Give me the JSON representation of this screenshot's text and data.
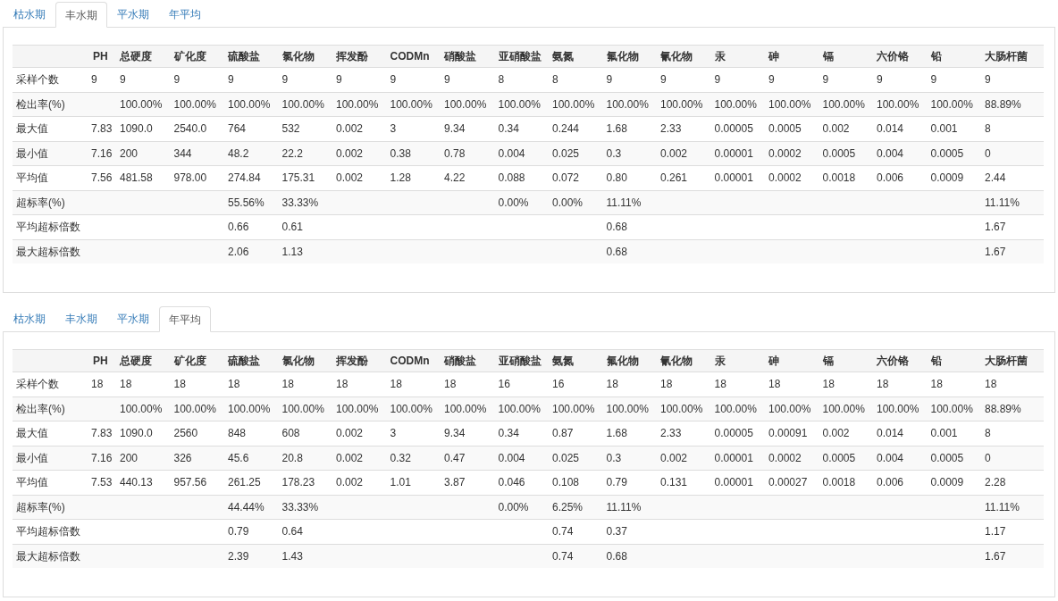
{
  "sections": [
    {
      "tabs": [
        {
          "label": "枯水期",
          "selected": false
        },
        {
          "label": "丰水期",
          "selected": true
        },
        {
          "label": "平水期",
          "selected": false
        },
        {
          "label": "年平均",
          "selected": false
        }
      ],
      "table": {
        "columns": [
          "PH",
          "总硬度",
          "矿化度",
          "硫酸盐",
          "氯化物",
          "挥发酚",
          "CODMn",
          "硝酸盐",
          "亚硝酸盐",
          "氨氮",
          "氟化物",
          "氰化物",
          "汞",
          "砷",
          "镉",
          "六价铬",
          "铅",
          "大肠杆菌"
        ],
        "rows": [
          {
            "label": "采样个数",
            "cells": [
              "9",
              "9",
              "9",
              "9",
              "9",
              "9",
              "9",
              "9",
              "8",
              "8",
              "9",
              "9",
              "9",
              "9",
              "9",
              "9",
              "9",
              "9"
            ]
          },
          {
            "label": "检出率(%)",
            "cells": [
              null,
              "100.00%",
              "100.00%",
              "100.00%",
              "100.00%",
              "100.00%",
              "100.00%",
              "100.00%",
              "100.00%",
              "100.00%",
              "100.00%",
              "100.00%",
              "100.00%",
              "100.00%",
              "100.00%",
              "100.00%",
              "100.00%",
              "88.89%"
            ]
          },
          {
            "label": "最大值",
            "cells": [
              "7.83",
              "1090.0",
              "2540.0",
              "764",
              "532",
              "0.002",
              "3",
              "9.34",
              "0.34",
              "0.244",
              "1.68",
              "2.33",
              "0.00005",
              "0.0005",
              "0.002",
              "0.014",
              "0.001",
              "8"
            ]
          },
          {
            "label": "最小值",
            "cells": [
              "7.16",
              "200",
              "344",
              "48.2",
              "22.2",
              "0.002",
              "0.38",
              "0.78",
              "0.004",
              "0.025",
              "0.3",
              "0.002",
              "0.00001",
              "0.0002",
              "0.0005",
              "0.004",
              "0.0005",
              "0"
            ]
          },
          {
            "label": "平均值",
            "cells": [
              "7.56",
              "481.58",
              "978.00",
              "274.84",
              "175.31",
              "0.002",
              "1.28",
              "4.22",
              "0.088",
              "0.072",
              "0.80",
              "0.261",
              "0.00001",
              "0.0002",
              "0.0018",
              "0.006",
              "0.0009",
              "2.44"
            ]
          },
          {
            "label": "超标率(%)",
            "cells": [
              null,
              null,
              null,
              "55.56%",
              "33.33%",
              null,
              null,
              null,
              "0.00%",
              "0.00%",
              "11.11%",
              null,
              null,
              null,
              null,
              null,
              null,
              "11.11%"
            ]
          },
          {
            "label": "平均超标倍数",
            "cells": [
              null,
              null,
              null,
              "0.66",
              "0.61",
              null,
              null,
              null,
              null,
              null,
              "0.68",
              null,
              null,
              null,
              null,
              null,
              null,
              "1.67"
            ]
          },
          {
            "label": "最大超标倍数",
            "cells": [
              null,
              null,
              null,
              "2.06",
              "1.13",
              null,
              null,
              null,
              null,
              null,
              "0.68",
              null,
              null,
              null,
              null,
              null,
              null,
              "1.67"
            ]
          }
        ]
      }
    },
    {
      "tabs": [
        {
          "label": "枯水期",
          "selected": false
        },
        {
          "label": "丰水期",
          "selected": false
        },
        {
          "label": "平水期",
          "selected": false
        },
        {
          "label": "年平均",
          "selected": true
        }
      ],
      "table": {
        "columns": [
          "PH",
          "总硬度",
          "矿化度",
          "硫酸盐",
          "氯化物",
          "挥发酚",
          "CODMn",
          "硝酸盐",
          "亚硝酸盐",
          "氨氮",
          "氟化物",
          "氰化物",
          "汞",
          "砷",
          "镉",
          "六价铬",
          "铅",
          "大肠杆菌"
        ],
        "rows": [
          {
            "label": "采样个数",
            "cells": [
              "18",
              "18",
              "18",
              "18",
              "18",
              "18",
              "18",
              "18",
              "16",
              "16",
              "18",
              "18",
              "18",
              "18",
              "18",
              "18",
              "18",
              "18"
            ]
          },
          {
            "label": "检出率(%)",
            "cells": [
              null,
              "100.00%",
              "100.00%",
              "100.00%",
              "100.00%",
              "100.00%",
              "100.00%",
              "100.00%",
              "100.00%",
              "100.00%",
              "100.00%",
              "100.00%",
              "100.00%",
              "100.00%",
              "100.00%",
              "100.00%",
              "100.00%",
              "88.89%"
            ]
          },
          {
            "label": "最大值",
            "cells": [
              "7.83",
              "1090.0",
              "2560",
              "848",
              "608",
              "0.002",
              "3",
              "9.34",
              "0.34",
              "0.87",
              "1.68",
              "2.33",
              "0.00005",
              "0.00091",
              "0.002",
              "0.014",
              "0.001",
              "8"
            ]
          },
          {
            "label": "最小值",
            "cells": [
              "7.16",
              "200",
              "326",
              "45.6",
              "20.8",
              "0.002",
              "0.32",
              "0.47",
              "0.004",
              "0.025",
              "0.3",
              "0.002",
              "0.00001",
              "0.0002",
              "0.0005",
              "0.004",
              "0.0005",
              "0"
            ]
          },
          {
            "label": "平均值",
            "cells": [
              "7.53",
              "440.13",
              "957.56",
              "261.25",
              "178.23",
              "0.002",
              "1.01",
              "3.87",
              "0.046",
              "0.108",
              "0.79",
              "0.131",
              "0.00001",
              "0.00027",
              "0.0018",
              "0.006",
              "0.0009",
              "2.28"
            ]
          },
          {
            "label": "超标率(%)",
            "cells": [
              null,
              null,
              null,
              "44.44%",
              "33.33%",
              null,
              null,
              null,
              "0.00%",
              "6.25%",
              "11.11%",
              null,
              null,
              null,
              null,
              null,
              null,
              "11.11%"
            ]
          },
          {
            "label": "平均超标倍数",
            "cells": [
              null,
              null,
              null,
              "0.79",
              "0.64",
              null,
              null,
              null,
              null,
              "0.74",
              "0.37",
              null,
              null,
              null,
              null,
              null,
              null,
              "1.17"
            ]
          },
          {
            "label": "最大超标倍数",
            "cells": [
              null,
              null,
              null,
              "2.39",
              "1.43",
              null,
              null,
              null,
              null,
              "0.74",
              "0.68",
              null,
              null,
              null,
              null,
              null,
              null,
              "1.67"
            ]
          }
        ]
      }
    }
  ]
}
